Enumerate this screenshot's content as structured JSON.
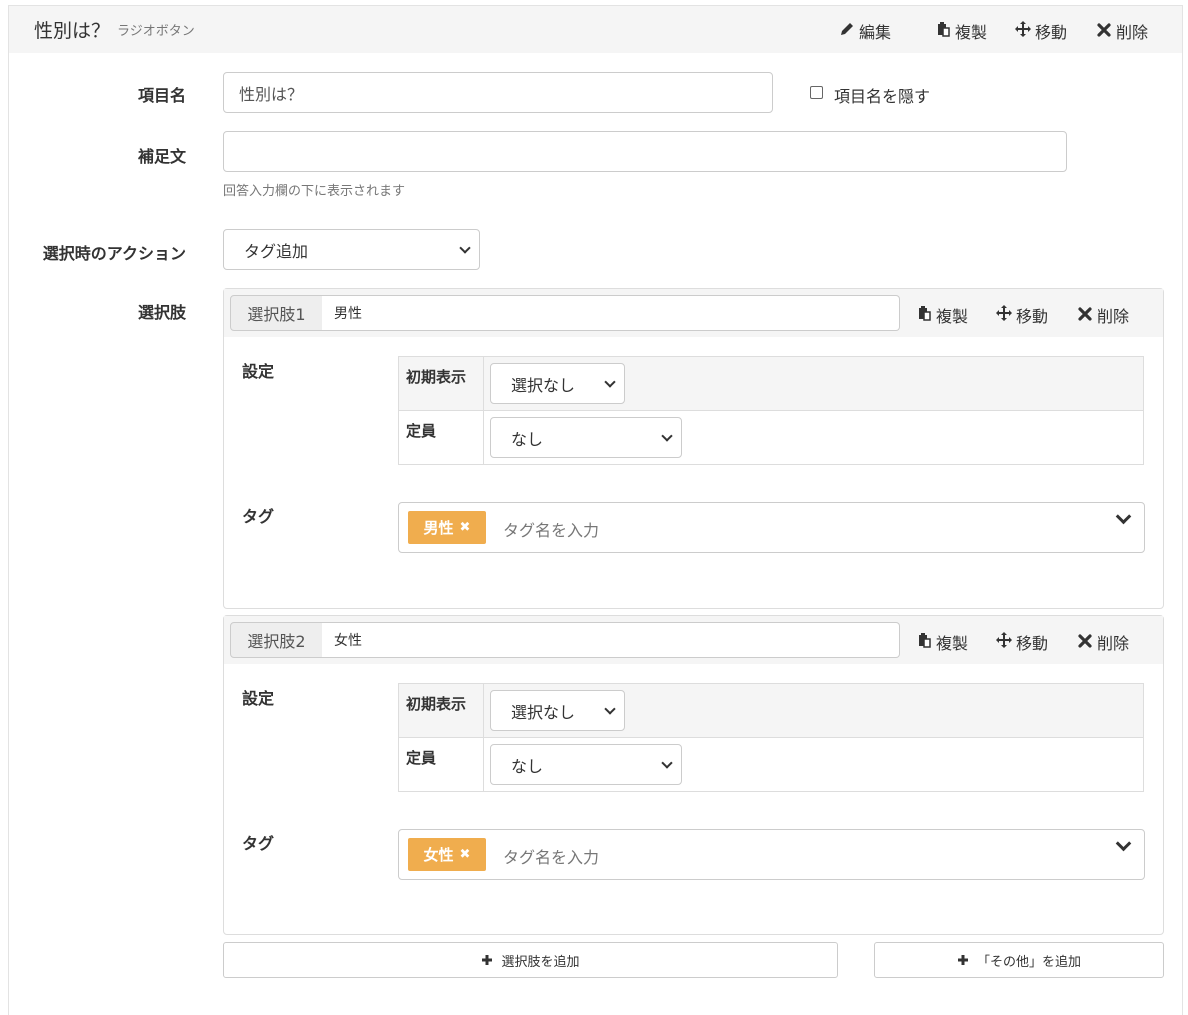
{
  "question": {
    "title": "性別は？",
    "type_label": "ラジオボタン",
    "actions": {
      "edit": "編集",
      "duplicate": "複製",
      "move": "移動",
      "delete": "削除"
    }
  },
  "form": {
    "item_name_label": "項目名",
    "item_name_value": "性別は？",
    "hide_name_label": "項目名を隠す",
    "supplement_label": "補足文",
    "supplement_value": "",
    "supplement_help": "回答入力欄の下に表示されます",
    "action_label": "選択時のアクション",
    "action_value": "タグ追加",
    "choices_label": "選択肢"
  },
  "choices": [
    {
      "addon": "選択肢1",
      "value": "男性",
      "actions": {
        "duplicate": "複製",
        "move": "移動",
        "delete": "削除"
      },
      "settings_label": "設定",
      "initial_label": "初期表示",
      "initial_value": "選択なし",
      "capacity_label": "定員",
      "capacity_value": "なし",
      "tag_label": "タグ",
      "tag": "男性",
      "tag_remove": "✖",
      "tag_placeholder": "タグ名を入力"
    },
    {
      "addon": "選択肢2",
      "value": "女性",
      "actions": {
        "duplicate": "複製",
        "move": "移動",
        "delete": "削除"
      },
      "settings_label": "設定",
      "initial_label": "初期表示",
      "initial_value": "選択なし",
      "capacity_label": "定員",
      "capacity_value": "なし",
      "tag_label": "タグ",
      "tag": "女性",
      "tag_remove": "✖",
      "tag_placeholder": "タグ名を入力"
    }
  ],
  "buttons": {
    "add_choice": "選択肢を追加",
    "add_other": "「その他」を追加"
  },
  "icons": {
    "edit": "pencil-icon",
    "duplicate": "paste-icon",
    "move": "move-arrows-icon",
    "delete": "times-icon",
    "add": "plus-icon"
  },
  "colors": {
    "tag_bg": "#f0ad4e",
    "header_bg": "#f5f5f5"
  }
}
